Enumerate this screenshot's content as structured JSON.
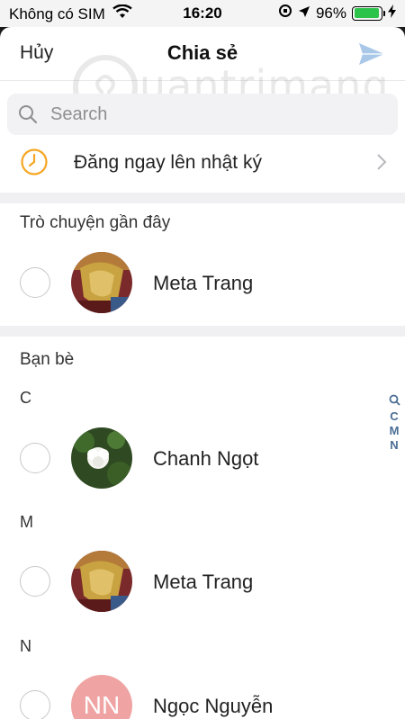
{
  "status_bar": {
    "carrier": "Không có SIM",
    "time": "16:20",
    "battery": "96%",
    "battery_level": 0.96,
    "wifi_icon": "wifi-icon",
    "location_icon": "location-arrow-icon",
    "charging_icon": "bolt-icon"
  },
  "nav": {
    "cancel": "Hủy",
    "title": "Chia sẻ",
    "send_icon": "paper-plane-icon"
  },
  "watermark": {
    "text": "uantrimang"
  },
  "search": {
    "placeholder": "Search"
  },
  "diary": {
    "label": "Đăng ngay lên nhật ký"
  },
  "recent": {
    "title": "Trò chuyện gần đây",
    "contacts": [
      {
        "name": "Meta Trang"
      }
    ]
  },
  "friends": {
    "title": "Bạn bè",
    "groups": [
      {
        "letter": "C",
        "contacts": [
          {
            "name": "Chanh Ngọt"
          }
        ]
      },
      {
        "letter": "M",
        "contacts": [
          {
            "name": "Meta Trang"
          }
        ]
      },
      {
        "letter": "N",
        "contacts": [
          {
            "name": "Ngọc Nguyễn",
            "initials": "NN"
          }
        ]
      }
    ]
  },
  "index": [
    "C",
    "M",
    "N"
  ],
  "colors": {
    "send_icon": "#a9c8e8",
    "clock_icon": "#f5a623",
    "index_text": "#4a6d94",
    "initials_avatar_bg": "#f0a3a3"
  }
}
